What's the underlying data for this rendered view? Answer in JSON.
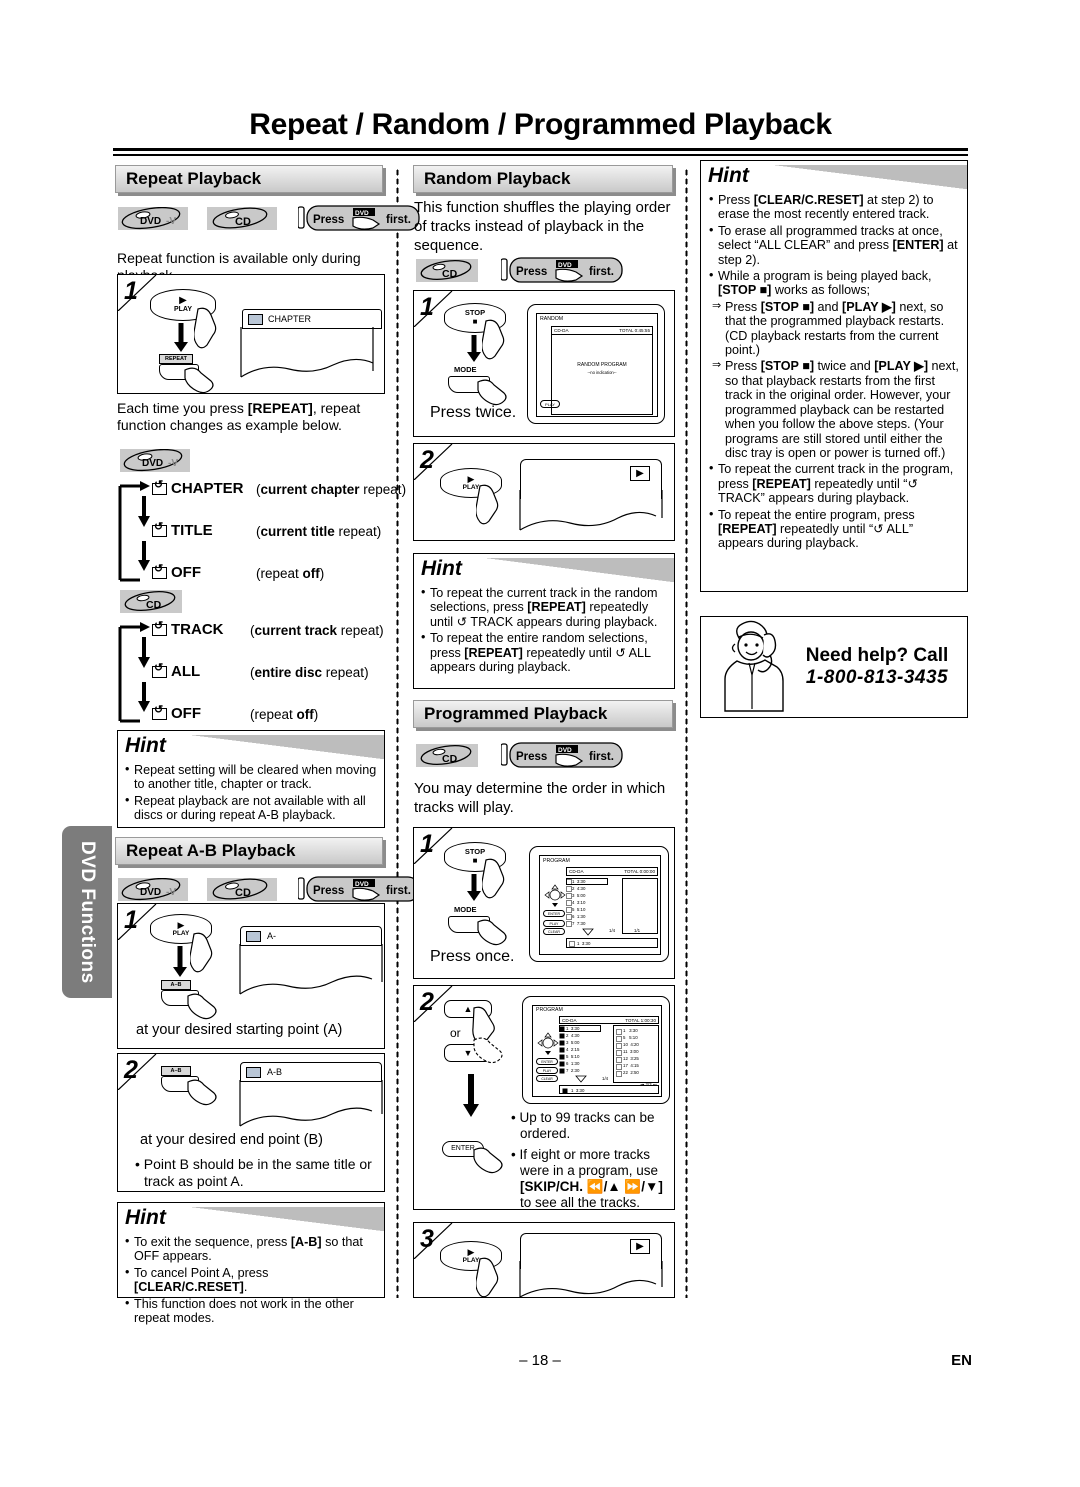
{
  "page": {
    "title": "Repeat / Random / Programmed Playback",
    "side_tab": "DVD Functions",
    "footer_page": "– 18 –",
    "footer_lang": "EN"
  },
  "sections": {
    "repeat_playback": {
      "heading": "Repeat Playback",
      "discs": [
        "DVD-V",
        "CD"
      ],
      "press_first": {
        "press": "Press",
        "disc": "DVD",
        "first": "first."
      },
      "intro": "Repeat function is available only during playback.",
      "step1": {
        "number": "1",
        "key_play": "PLAY",
        "key_repeat": "REPEAT",
        "osd_text": "CHAPTER"
      },
      "after_step": "Each time you press [REPEAT], repeat function changes as example below.",
      "flow_dvd": {
        "disc": "DVD-V",
        "rows": [
          {
            "label": "CHAPTER",
            "desc_bold": "current chapter",
            "desc_rest": " repeat",
            "paren": true
          },
          {
            "label": "TITLE",
            "desc_bold": "current title",
            "desc_rest": " repeat",
            "paren": true
          },
          {
            "label": "OFF",
            "desc_bold": "",
            "desc_rest": "repeat ",
            "desc_bold_tail": "off",
            "paren": true
          }
        ]
      },
      "flow_cd": {
        "disc": "CD",
        "rows": [
          {
            "label": "TRACK",
            "desc_bold": "current track",
            "desc_rest": " repeat",
            "paren": true
          },
          {
            "label": "ALL",
            "desc_bold": "entire disc",
            "desc_rest": " repeat",
            "paren": true
          },
          {
            "label": "OFF",
            "desc_bold": "",
            "desc_rest": "repeat ",
            "desc_bold_tail": "off",
            "paren": true
          }
        ]
      },
      "hint": {
        "title": "Hint",
        "items": [
          "Repeat setting will be cleared when moving to another title, chapter or track.",
          "Repeat playback are not available with all discs or during repeat A-B playback."
        ]
      }
    },
    "repeat_ab": {
      "heading": "Repeat A-B Playback",
      "discs": [
        "DVD-V",
        "CD"
      ],
      "press_first": {
        "press": "Press",
        "disc": "DVD",
        "first": "first."
      },
      "step1": {
        "number": "1",
        "key_play": "PLAY",
        "key_ab": "A–B",
        "osd_text": "A-",
        "caption": "at your desired starting point (A)"
      },
      "step2": {
        "number": "2",
        "key_ab": "A–B",
        "osd_text": "A-B",
        "caption": "at your desired end point (B)",
        "note": "Point B should be in the same title or track as point A."
      },
      "hint": {
        "title": "Hint",
        "items": [
          "To exit the sequence, press [A-B] so that OFF appears.",
          "To cancel Point A, press [CLEAR/C.RESET].",
          "This function does not work in the other repeat modes."
        ]
      }
    },
    "random_playback": {
      "heading": "Random Playback",
      "intro": "This function shuffles the playing order of tracks instead of playback in the sequence.",
      "discs": [
        "CD"
      ],
      "press_first": {
        "press": "Press",
        "disc": "DVD",
        "first": "first."
      },
      "step1": {
        "number": "1",
        "key_stop": "STOP",
        "key_mode": "MODE",
        "caption": "Press twice.",
        "osd": {
          "title": "RANDOM",
          "disc_type": "CD-DA",
          "total": "TOTAL 0:45:55",
          "center_line1": "RANDOM PROGRAM",
          "center_line2": "--no indication--",
          "corner": "PLAY"
        }
      },
      "step2": {
        "number": "2",
        "key_play": "PLAY",
        "badge": "▶"
      },
      "hint": {
        "title": "Hint",
        "items": [
          "To repeat the current track in the random selections, press [REPEAT] repeatedly until ↺ TRACK appears during playback.",
          "To repeat the entire random selections, press [REPEAT] repeatedly until ↺ ALL appears during playback."
        ]
      }
    },
    "programmed_playback": {
      "heading": "Programmed Playback",
      "discs": [
        "CD"
      ],
      "press_first": {
        "press": "Press",
        "disc": "DVD",
        "first": "first."
      },
      "intro": "You may determine the order in which tracks will play.",
      "step1": {
        "number": "1",
        "key_stop": "STOP",
        "key_mode": "MODE",
        "caption": "Press once.",
        "osd": {
          "title": "PROGRAM",
          "disc_type": "CD-DA",
          "total": "TOTAL 0:00:00",
          "tracks": [
            "1  3:30",
            "2  4:30",
            "3  5:00",
            "4  3:10",
            "5  5:10",
            "6  1:30",
            "7  7:30"
          ],
          "page_left": "1/4",
          "page_right": "1/1",
          "selected": "1  3:30",
          "keys": [
            "ENTER",
            "PLAY",
            "CLEAR"
          ]
        }
      },
      "step2": {
        "number": "2",
        "key_up": "▲",
        "key_or": "or",
        "key_down": "▼",
        "key_enter": "ENTER",
        "osd": {
          "title": "PROGRAM",
          "disc_type": "CD-DA",
          "total": "TOTAL 1:00:30",
          "tracks_left": [
            "1  3:30",
            "2  4:30",
            "3  5:00",
            "4  2:15",
            "5  5:10",
            "6  1:30",
            "7  2:30"
          ],
          "tracks_right": [
            "1   3:30",
            "5   5:10",
            "10  4:20",
            "11  3:00",
            "12  3:25",
            "17  4:15",
            "22  2:50"
          ],
          "page_left": "1/4",
          "page_right": "2/3",
          "selected": "1  3:30"
        },
        "notes": [
          "Up to 99 tracks can be ordered.",
          "If eight or more tracks were in a program, use [SKIP/CH. ⏪/▲ ⏩/▼] to see all the tracks."
        ]
      },
      "step3": {
        "number": "3",
        "key_play": "PLAY",
        "badge": "▶"
      }
    },
    "hint_right": {
      "title": "Hint",
      "items": [
        {
          "type": "bullet",
          "text": "Press [CLEAR/C.RESET] at step 2) to erase the most recently entered track."
        },
        {
          "type": "bullet",
          "text": "To erase all programmed tracks at once, select “ALL CLEAR” and press [ENTER] at step 2)."
        },
        {
          "type": "bullet",
          "text": "While a program is being played back, [STOP ■] works as follows;"
        },
        {
          "type": "sub",
          "text": "Press [STOP ■] and [PLAY ▶] next, so that the programmed playback restarts. (CD playback restarts from the current point.)"
        },
        {
          "type": "sub",
          "text": "Press [STOP ■] twice and [PLAY ▶] next, so that playback restarts from the first track in the original order. However, your programmed playback can be restarted when you follow the above steps. (Your programs are still stored until either the disc tray is open or power is turned off.)"
        },
        {
          "type": "bullet",
          "text": "To repeat the current track in the program, press [REPEAT] repeatedly until “↺ TRACK” appears during playback."
        },
        {
          "type": "bullet",
          "text": "To repeat the entire program, press [REPEAT] repeatedly until “↺ ALL” appears during playback."
        }
      ]
    },
    "help": {
      "line1": "Need help? Call",
      "line2": "1-800-813-3435"
    }
  }
}
